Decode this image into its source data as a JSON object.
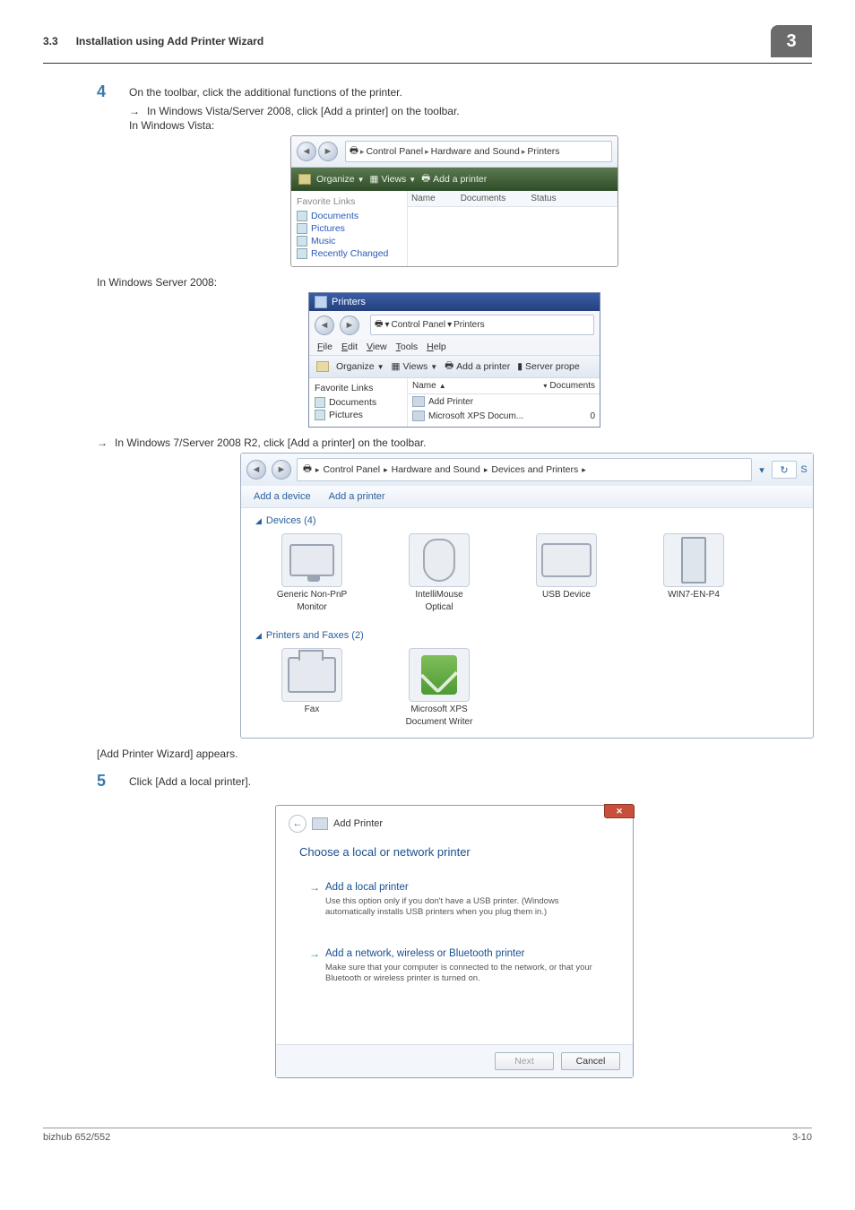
{
  "header": {
    "section_number": "3.3",
    "section_title": "Installation using Add Printer Wizard",
    "chapter_badge": "3"
  },
  "footer": {
    "product": "bizhub 652/552",
    "page": "3-10"
  },
  "step4": {
    "num": "4",
    "text": "On the toolbar, click the additional functions of the printer.",
    "sub1": "In Windows Vista/Server 2008, click [Add a printer] on the toolbar.",
    "vista_label": "In Windows Vista:",
    "server_label": "In Windows Server 2008:",
    "sub2": "In Windows 7/Server 2008 R2, click [Add a printer] on the toolbar."
  },
  "after_w7": "[Add Printer Wizard] appears.",
  "step5": {
    "num": "5",
    "text": "Click [Add a local printer]."
  },
  "vista_wnd": {
    "crumb1": "Control Panel",
    "crumb2": "Hardware and Sound",
    "crumb3": "Printers",
    "tb_organize": "Organize",
    "tb_views": "Views",
    "tb_addprinter": "Add a printer",
    "col_name": "Name",
    "col_docs": "Documents",
    "col_status": "Status",
    "fav_header": "Favorite Links",
    "fav_documents": "Documents",
    "fav_pictures": "Pictures",
    "fav_music": "Music",
    "fav_recently": "Recently Changed"
  },
  "s08_wnd": {
    "title": "Printers",
    "crumb1": "Control Panel",
    "crumb2": "Printers",
    "menu_file": "File",
    "menu_edit": "Edit",
    "menu_view": "View",
    "menu_tools": "Tools",
    "menu_help": "Help",
    "tb_organize": "Organize",
    "tb_views": "Views",
    "tb_addprinter": "Add a printer",
    "tb_serverprops": "Server prope",
    "fav_header": "Favorite Links",
    "fav_documents": "Documents",
    "fav_pictures": "Pictures",
    "col_name": "Name",
    "col_docs": "Documents",
    "item_add": "Add Printer",
    "item_xps": "Microsoft XPS Docum...",
    "item_xps_docs": "0"
  },
  "w7_wnd": {
    "crumb1": "Control Panel",
    "crumb2": "Hardware and Sound",
    "crumb3": "Devices and Printers",
    "tb_adddevice": "Add a device",
    "tb_addprinter": "Add a printer",
    "sec_devices": "Devices (4)",
    "sec_printers": "Printers and Faxes (2)",
    "dev1a": "Generic Non-PnP",
    "dev1b": "Monitor",
    "dev2a": "IntelliMouse",
    "dev2b": "Optical",
    "dev3": "USB Device",
    "dev4": "WIN7-EN-P4",
    "pf1": "Fax",
    "pf2a": "Microsoft XPS",
    "pf2b": "Document Writer"
  },
  "wiz": {
    "hdr": "Add Printer",
    "title": "Choose a local or network printer",
    "opt1_hd": "Add a local printer",
    "opt1_desc": "Use this option only if you don't have a USB printer. (Windows automatically installs USB printers when you plug them in.)",
    "opt2_hd": "Add a network, wireless or Bluetooth printer",
    "opt2_desc": "Make sure that your computer is connected to the network, or that your Bluetooth or wireless printer is turned on.",
    "btn_next": "Next",
    "btn_cancel": "Cancel"
  }
}
